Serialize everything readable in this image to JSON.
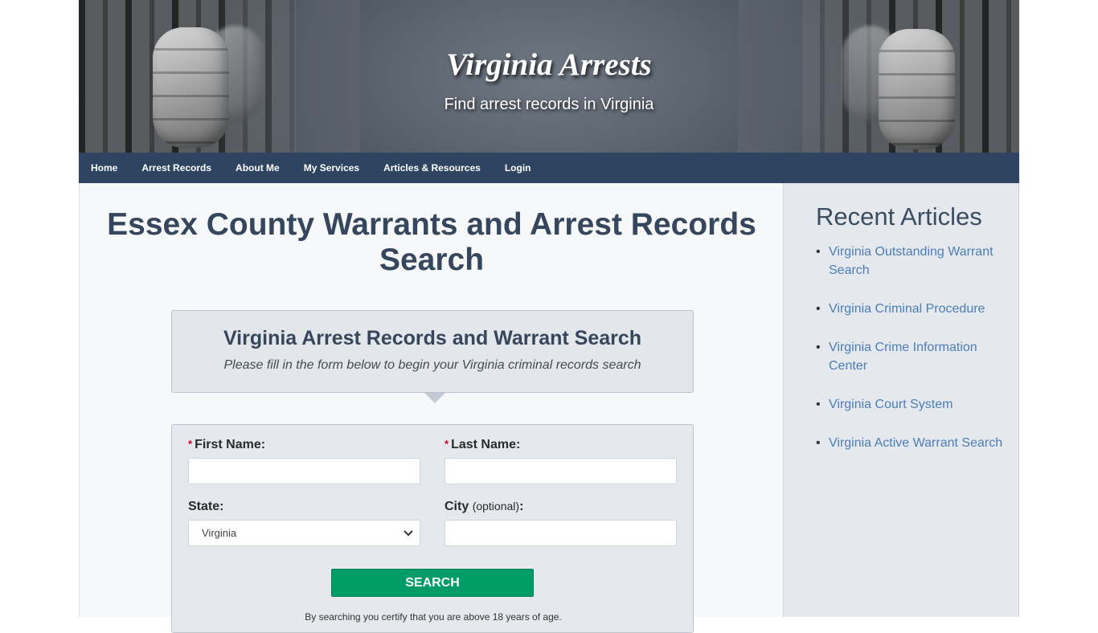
{
  "header": {
    "site_title": "Virginia Arrests",
    "tagline": "Find arrest records in Virginia"
  },
  "nav": {
    "items": [
      {
        "label": "Home"
      },
      {
        "label": "Arrest Records"
      },
      {
        "label": "About Me"
      },
      {
        "label": "My Services"
      },
      {
        "label": "Articles & Resources"
      },
      {
        "label": "Login"
      }
    ]
  },
  "main": {
    "page_title": "Essex County Warrants and Arrest Records Search",
    "callout": {
      "title": "Virginia Arrest Records and Warrant Search",
      "subtitle": "Please fill in the form below to begin your Virginia criminal records search"
    },
    "form": {
      "required_mark": "*",
      "first_name": {
        "label": "First Name:",
        "value": ""
      },
      "last_name": {
        "label": "Last Name:",
        "value": ""
      },
      "state": {
        "label": "State:",
        "selected": "Virginia"
      },
      "city": {
        "label": "City",
        "optional": "(optional)",
        "colon": ":",
        "value": ""
      },
      "search_label": "SEARCH",
      "certify_text": "By searching you certify that you are above 18 years of age."
    }
  },
  "sidebar": {
    "title": "Recent Articles",
    "articles": [
      {
        "label": "Virginia Outstanding Warrant Search"
      },
      {
        "label": "Virginia Criminal Procedure"
      },
      {
        "label": "Virginia Crime Information Center"
      },
      {
        "label": "Virginia Court System"
      },
      {
        "label": "Virginia Active Warrant Search"
      }
    ]
  },
  "colors": {
    "nav_bg": "#2e4460",
    "title_text": "#36475d",
    "search_button": "#009c68",
    "link": "#4c7db6",
    "required": "#d0021b"
  }
}
